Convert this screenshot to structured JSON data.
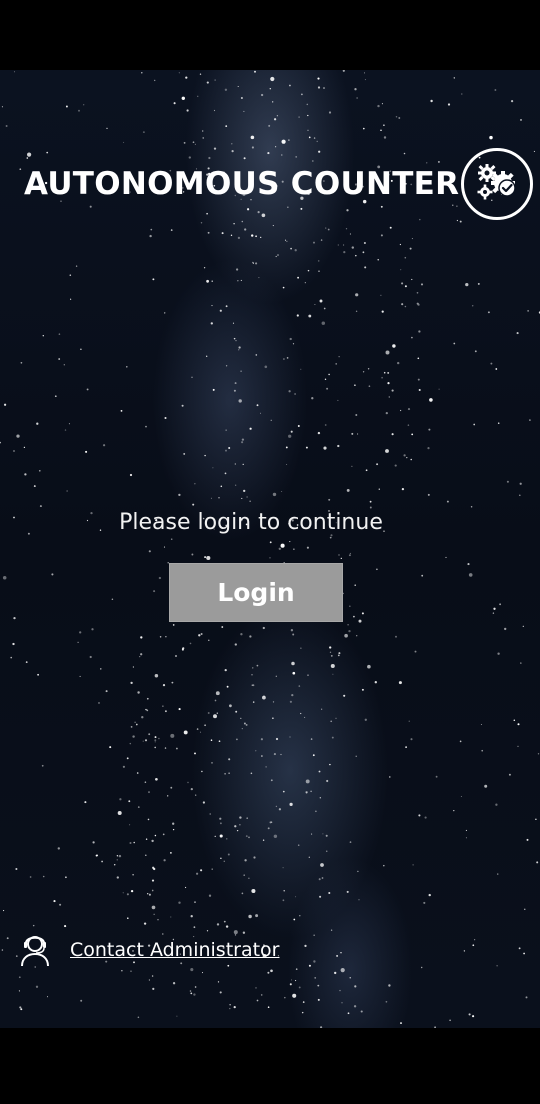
{
  "app": {
    "title": "AUTONOMOUS COUNTER"
  },
  "settings": {
    "icon": "gears-check-icon"
  },
  "main": {
    "prompt": "Please login to continue",
    "login_label": "Login"
  },
  "footer": {
    "contact_icon": "user-headset-icon",
    "contact_label": "Contact Administrator"
  },
  "colors": {
    "background": "#0a101c",
    "text": "#ffffff",
    "login_button": "#9b9b9b"
  }
}
